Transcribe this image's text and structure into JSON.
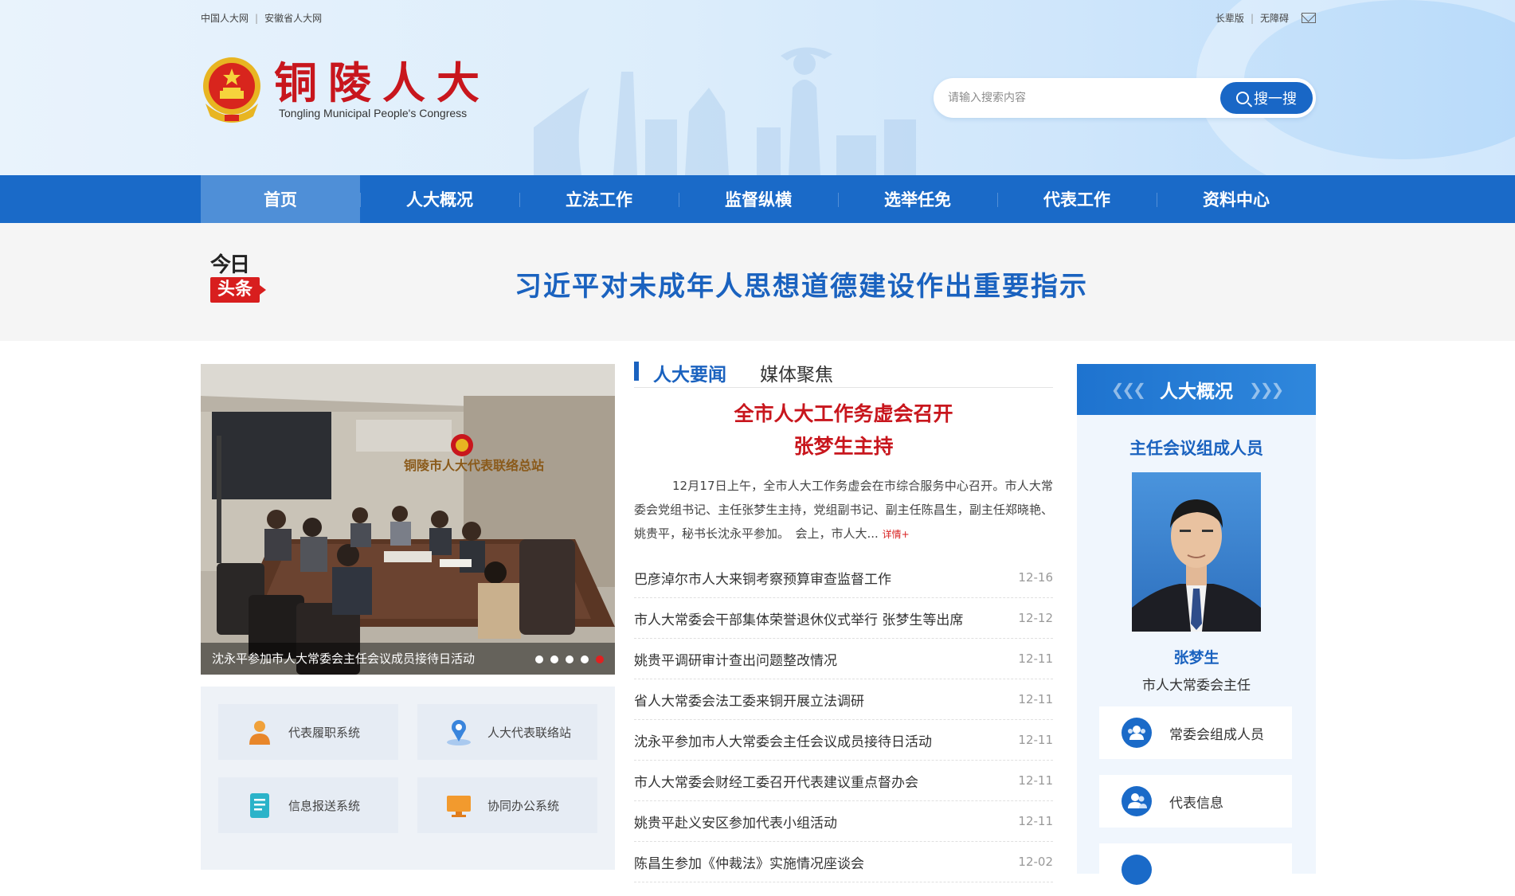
{
  "top_links_left": [
    "中国人大网",
    "安徽省人大网"
  ],
  "top_links_right": [
    "长辈版",
    "无障碍"
  ],
  "logo": {
    "cn": "铜陵人大",
    "en": "Tongling Municipal People's Congress"
  },
  "search": {
    "placeholder": "请输入搜索内容",
    "button": "搜一搜"
  },
  "nav": [
    "首页",
    "人大概况",
    "立法工作",
    "监督纵横",
    "选举任免",
    "代表工作",
    "资料中心"
  ],
  "headline": {
    "badge_top": "今日",
    "badge_bottom": "头条",
    "text": "习近平对未成年人思想道德建设作出重要指示"
  },
  "slider": {
    "caption": "沈永平参加市人大常委会主任会议成员接待日活动",
    "sign_text": "铜陵市人大代表联络总站",
    "dots": 5,
    "active_dot": 5
  },
  "quick_links": [
    "代表履职系统",
    "人大代表联络站",
    "信息报送系统",
    "协同办公系统"
  ],
  "news": {
    "tabs": [
      "人大要闻",
      "媒体聚焦"
    ],
    "feature_title_1": "全市人大工作务虚会召开",
    "feature_title_2": "张梦生主持",
    "feature_body": "12月17日上午，全市人大工作务虚会在市综合服务中心召开。市人大常委会党组书记、主任张梦生主持，党组副书记、副主任陈昌生，副主任郑晓艳、姚贵平，秘书长沈永平参加。　会上，市人大...",
    "more": "详情+",
    "items": [
      {
        "title": "巴彦淖尔市人大来铜考察预算审查监督工作",
        "date": "12-16"
      },
      {
        "title": "市人大常委会干部集体荣誉退休仪式举行 张梦生等出席",
        "date": "12-12"
      },
      {
        "title": "姚贵平调研审计查出问题整改情况",
        "date": "12-11"
      },
      {
        "title": "省人大常委会法工委来铜开展立法调研",
        "date": "12-11"
      },
      {
        "title": "沈永平参加市人大常委会主任会议成员接待日活动",
        "date": "12-11"
      },
      {
        "title": "市人大常委会财经工委召开代表建议重点督办会",
        "date": "12-11"
      },
      {
        "title": "姚贵平赴义安区参加代表小组活动",
        "date": "12-11"
      },
      {
        "title": "陈昌生参加《仲裁法》实施情况座谈会",
        "date": "12-02"
      }
    ]
  },
  "side": {
    "title": "人大概况",
    "subtitle": "主任会议组成人员",
    "person_name": "张梦生",
    "person_title": "市人大常委会主任",
    "buttons": [
      "常委会组成人员",
      "代表信息"
    ]
  }
}
